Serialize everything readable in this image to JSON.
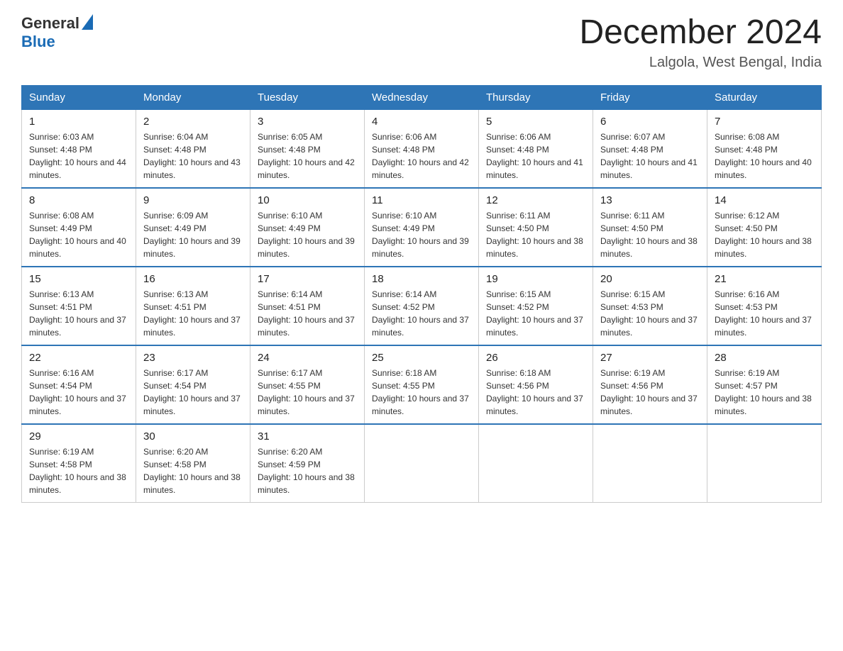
{
  "header": {
    "logo_general": "General",
    "logo_blue": "Blue",
    "month_title": "December 2024",
    "location": "Lalgola, West Bengal, India"
  },
  "calendar": {
    "days_of_week": [
      "Sunday",
      "Monday",
      "Tuesday",
      "Wednesday",
      "Thursday",
      "Friday",
      "Saturday"
    ],
    "weeks": [
      [
        {
          "day": "1",
          "sunrise": "Sunrise: 6:03 AM",
          "sunset": "Sunset: 4:48 PM",
          "daylight": "Daylight: 10 hours and 44 minutes."
        },
        {
          "day": "2",
          "sunrise": "Sunrise: 6:04 AM",
          "sunset": "Sunset: 4:48 PM",
          "daylight": "Daylight: 10 hours and 43 minutes."
        },
        {
          "day": "3",
          "sunrise": "Sunrise: 6:05 AM",
          "sunset": "Sunset: 4:48 PM",
          "daylight": "Daylight: 10 hours and 42 minutes."
        },
        {
          "day": "4",
          "sunrise": "Sunrise: 6:06 AM",
          "sunset": "Sunset: 4:48 PM",
          "daylight": "Daylight: 10 hours and 42 minutes."
        },
        {
          "day": "5",
          "sunrise": "Sunrise: 6:06 AM",
          "sunset": "Sunset: 4:48 PM",
          "daylight": "Daylight: 10 hours and 41 minutes."
        },
        {
          "day": "6",
          "sunrise": "Sunrise: 6:07 AM",
          "sunset": "Sunset: 4:48 PM",
          "daylight": "Daylight: 10 hours and 41 minutes."
        },
        {
          "day": "7",
          "sunrise": "Sunrise: 6:08 AM",
          "sunset": "Sunset: 4:48 PM",
          "daylight": "Daylight: 10 hours and 40 minutes."
        }
      ],
      [
        {
          "day": "8",
          "sunrise": "Sunrise: 6:08 AM",
          "sunset": "Sunset: 4:49 PM",
          "daylight": "Daylight: 10 hours and 40 minutes."
        },
        {
          "day": "9",
          "sunrise": "Sunrise: 6:09 AM",
          "sunset": "Sunset: 4:49 PM",
          "daylight": "Daylight: 10 hours and 39 minutes."
        },
        {
          "day": "10",
          "sunrise": "Sunrise: 6:10 AM",
          "sunset": "Sunset: 4:49 PM",
          "daylight": "Daylight: 10 hours and 39 minutes."
        },
        {
          "day": "11",
          "sunrise": "Sunrise: 6:10 AM",
          "sunset": "Sunset: 4:49 PM",
          "daylight": "Daylight: 10 hours and 39 minutes."
        },
        {
          "day": "12",
          "sunrise": "Sunrise: 6:11 AM",
          "sunset": "Sunset: 4:50 PM",
          "daylight": "Daylight: 10 hours and 38 minutes."
        },
        {
          "day": "13",
          "sunrise": "Sunrise: 6:11 AM",
          "sunset": "Sunset: 4:50 PM",
          "daylight": "Daylight: 10 hours and 38 minutes."
        },
        {
          "day": "14",
          "sunrise": "Sunrise: 6:12 AM",
          "sunset": "Sunset: 4:50 PM",
          "daylight": "Daylight: 10 hours and 38 minutes."
        }
      ],
      [
        {
          "day": "15",
          "sunrise": "Sunrise: 6:13 AM",
          "sunset": "Sunset: 4:51 PM",
          "daylight": "Daylight: 10 hours and 37 minutes."
        },
        {
          "day": "16",
          "sunrise": "Sunrise: 6:13 AM",
          "sunset": "Sunset: 4:51 PM",
          "daylight": "Daylight: 10 hours and 37 minutes."
        },
        {
          "day": "17",
          "sunrise": "Sunrise: 6:14 AM",
          "sunset": "Sunset: 4:51 PM",
          "daylight": "Daylight: 10 hours and 37 minutes."
        },
        {
          "day": "18",
          "sunrise": "Sunrise: 6:14 AM",
          "sunset": "Sunset: 4:52 PM",
          "daylight": "Daylight: 10 hours and 37 minutes."
        },
        {
          "day": "19",
          "sunrise": "Sunrise: 6:15 AM",
          "sunset": "Sunset: 4:52 PM",
          "daylight": "Daylight: 10 hours and 37 minutes."
        },
        {
          "day": "20",
          "sunrise": "Sunrise: 6:15 AM",
          "sunset": "Sunset: 4:53 PM",
          "daylight": "Daylight: 10 hours and 37 minutes."
        },
        {
          "day": "21",
          "sunrise": "Sunrise: 6:16 AM",
          "sunset": "Sunset: 4:53 PM",
          "daylight": "Daylight: 10 hours and 37 minutes."
        }
      ],
      [
        {
          "day": "22",
          "sunrise": "Sunrise: 6:16 AM",
          "sunset": "Sunset: 4:54 PM",
          "daylight": "Daylight: 10 hours and 37 minutes."
        },
        {
          "day": "23",
          "sunrise": "Sunrise: 6:17 AM",
          "sunset": "Sunset: 4:54 PM",
          "daylight": "Daylight: 10 hours and 37 minutes."
        },
        {
          "day": "24",
          "sunrise": "Sunrise: 6:17 AM",
          "sunset": "Sunset: 4:55 PM",
          "daylight": "Daylight: 10 hours and 37 minutes."
        },
        {
          "day": "25",
          "sunrise": "Sunrise: 6:18 AM",
          "sunset": "Sunset: 4:55 PM",
          "daylight": "Daylight: 10 hours and 37 minutes."
        },
        {
          "day": "26",
          "sunrise": "Sunrise: 6:18 AM",
          "sunset": "Sunset: 4:56 PM",
          "daylight": "Daylight: 10 hours and 37 minutes."
        },
        {
          "day": "27",
          "sunrise": "Sunrise: 6:19 AM",
          "sunset": "Sunset: 4:56 PM",
          "daylight": "Daylight: 10 hours and 37 minutes."
        },
        {
          "day": "28",
          "sunrise": "Sunrise: 6:19 AM",
          "sunset": "Sunset: 4:57 PM",
          "daylight": "Daylight: 10 hours and 38 minutes."
        }
      ],
      [
        {
          "day": "29",
          "sunrise": "Sunrise: 6:19 AM",
          "sunset": "Sunset: 4:58 PM",
          "daylight": "Daylight: 10 hours and 38 minutes."
        },
        {
          "day": "30",
          "sunrise": "Sunrise: 6:20 AM",
          "sunset": "Sunset: 4:58 PM",
          "daylight": "Daylight: 10 hours and 38 minutes."
        },
        {
          "day": "31",
          "sunrise": "Sunrise: 6:20 AM",
          "sunset": "Sunset: 4:59 PM",
          "daylight": "Daylight: 10 hours and 38 minutes."
        },
        null,
        null,
        null,
        null
      ]
    ]
  }
}
